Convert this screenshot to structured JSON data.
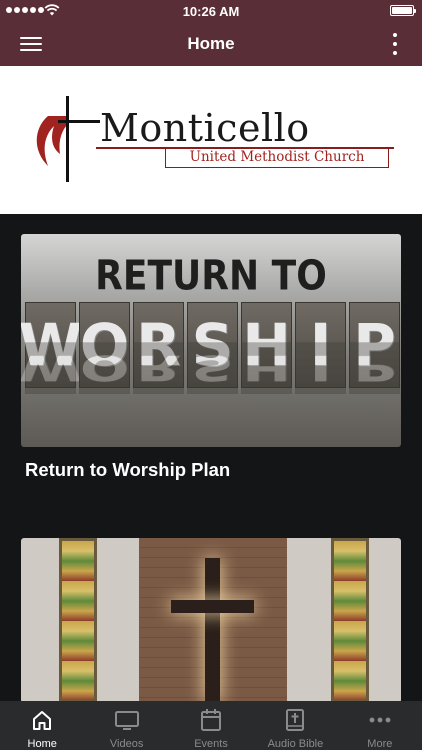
{
  "status_bar": {
    "time": "10:26 AM"
  },
  "nav": {
    "title": "Home"
  },
  "logo": {
    "name": "Monticello",
    "subtitle": "United Methodist Church"
  },
  "cards": [
    {
      "title": "Return to Worship Plan",
      "image_text": {
        "top": "RETURN TO",
        "blocks": [
          "W",
          "O",
          "R",
          "S",
          "H",
          "I",
          "P"
        ]
      }
    },
    {
      "title": ""
    }
  ],
  "tabs": [
    {
      "label": "Home",
      "icon": "home-icon",
      "active": true
    },
    {
      "label": "Videos",
      "icon": "tv-icon",
      "active": false
    },
    {
      "label": "Events",
      "icon": "calendar-icon",
      "active": false
    },
    {
      "label": "Audio Bible",
      "icon": "bible-icon",
      "active": false
    },
    {
      "label": "More",
      "icon": "ellipsis-icon",
      "active": false
    }
  ],
  "colors": {
    "header": "#5a2e36",
    "background": "#141516",
    "tab_bar": "#2a2b2d",
    "logo_red": "#a0231f"
  }
}
